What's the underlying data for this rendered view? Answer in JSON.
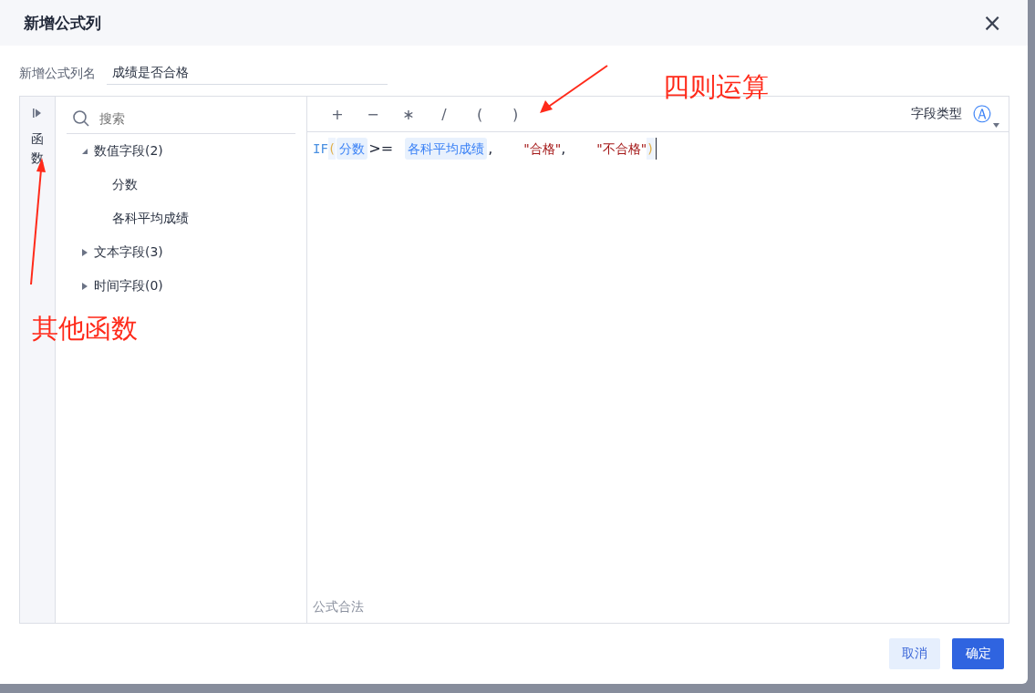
{
  "dialog": {
    "title": "新增公式列",
    "close": "×"
  },
  "name_field": {
    "label": "新增公式列名",
    "value": "成绩是否合格"
  },
  "function_tab": {
    "label": "函数"
  },
  "search": {
    "placeholder": "搜索"
  },
  "tree": [
    {
      "label": "数值字段(2)",
      "expanded": true,
      "children": [
        {
          "label": "分数"
        },
        {
          "label": "各科平均成绩"
        }
      ]
    },
    {
      "label": "文本字段(3)",
      "expanded": false
    },
    {
      "label": "时间字段(0)",
      "expanded": false
    }
  ],
  "operators": [
    "+",
    "−",
    "∗",
    "/",
    "(",
    ")"
  ],
  "field_type": {
    "label": "字段类型",
    "icon": "Ⓐ"
  },
  "formula": [
    {
      "kind": "func",
      "text": "IF"
    },
    {
      "kind": "paren",
      "text": "("
    },
    {
      "kind": "field",
      "text": "分数"
    },
    {
      "kind": "op",
      "text": ">="
    },
    {
      "kind": "field",
      "text": "各科平均成绩"
    },
    {
      "kind": "op",
      "text": ","
    },
    {
      "kind": "string",
      "text": "\"合格\""
    },
    {
      "kind": "op",
      "text": ","
    },
    {
      "kind": "string",
      "text": "\"不合格\""
    },
    {
      "kind": "paren",
      "text": ")"
    }
  ],
  "status": "公式合法",
  "buttons": [
    {
      "label": "取消",
      "kind": "secondary"
    },
    {
      "label": "确定",
      "kind": "primary"
    }
  ],
  "annotations": [
    {
      "text": "四则运算",
      "kind": "top"
    },
    {
      "text": "其他函数",
      "kind": "left"
    }
  ]
}
